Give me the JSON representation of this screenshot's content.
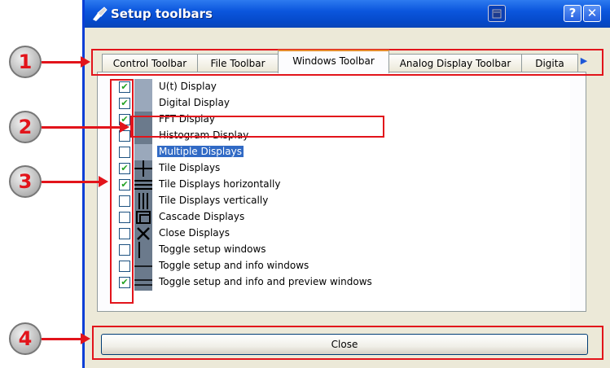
{
  "window": {
    "title": "Setup toolbars"
  },
  "titlebar_buttons": {
    "help": "?",
    "close": "✕"
  },
  "tabs": [
    {
      "label": "Control Toolbar"
    },
    {
      "label": "File Toolbar"
    },
    {
      "label": "Windows Toolbar",
      "active": true
    },
    {
      "label": "Analog Display Toolbar"
    },
    {
      "label": "Digita"
    }
  ],
  "tab_scroll": "▶",
  "items": [
    {
      "label": "U(t) Display",
      "checked": true
    },
    {
      "label": "Digital Display",
      "checked": true
    },
    {
      "label": "FFT Display",
      "checked": true
    },
    {
      "label": "Histogram Display",
      "checked": false
    },
    {
      "label": "Multiple Displays",
      "checked": false,
      "selected": true
    },
    {
      "label": "Tile Displays",
      "checked": true
    },
    {
      "label": "Tile Displays horizontally",
      "checked": true
    },
    {
      "label": "Tile Displays vertically",
      "checked": false
    },
    {
      "label": "Cascade Displays",
      "checked": false
    },
    {
      "label": "Close Displays",
      "checked": false
    },
    {
      "label": "Toggle setup windows",
      "checked": false
    },
    {
      "label": "Toggle setup and info windows",
      "checked": false
    },
    {
      "label": "Toggle setup and info and preview windows",
      "checked": true
    }
  ],
  "close_button": "Close",
  "callouts": [
    "1",
    "2",
    "3",
    "4"
  ],
  "colors": {
    "titlebar": "#0b56dd",
    "highlight": "#e2141b",
    "selection": "#316ac5"
  }
}
